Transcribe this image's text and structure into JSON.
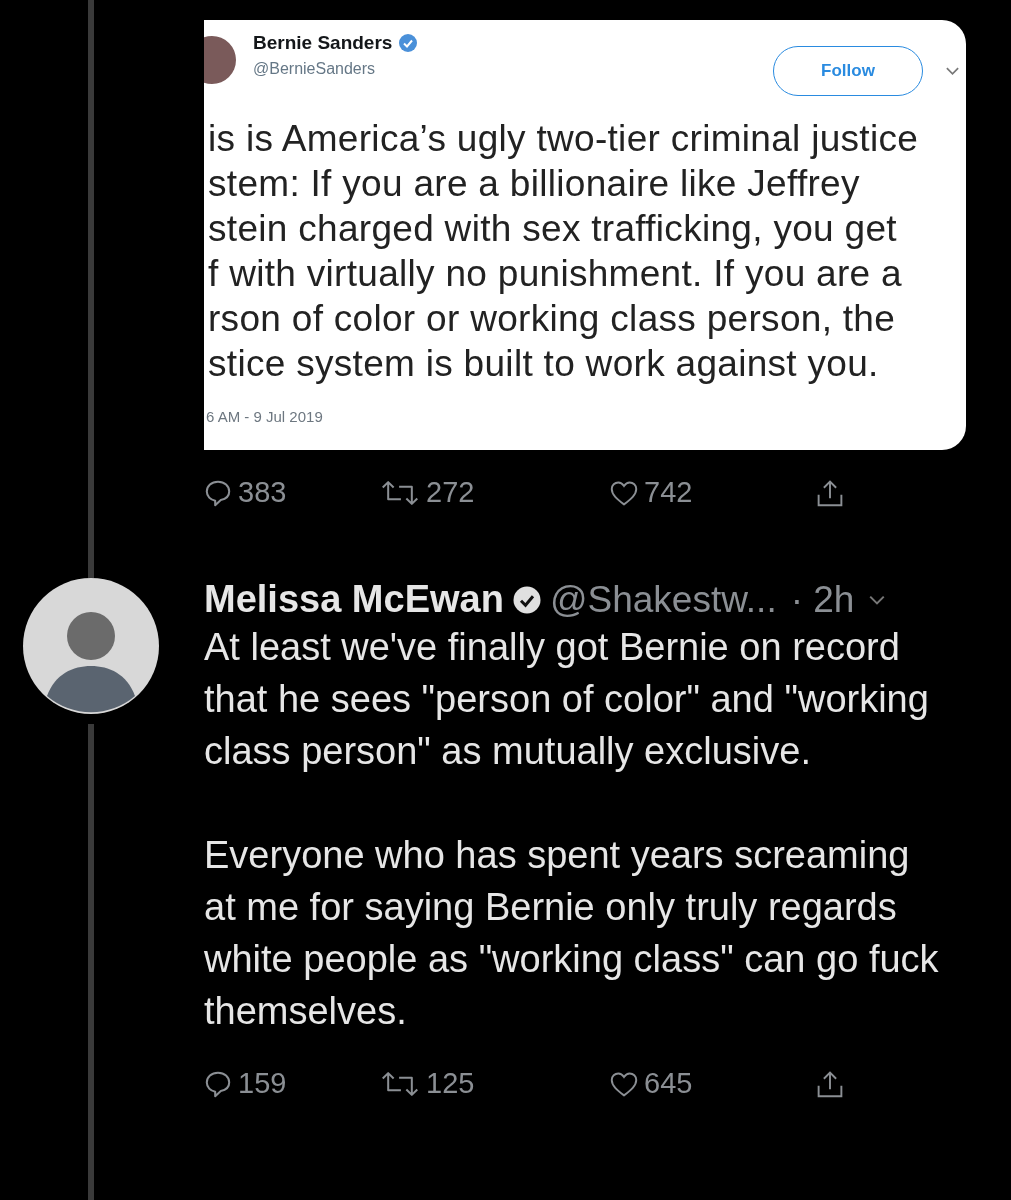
{
  "quoted_tweet": {
    "author_name": "Bernie Sanders",
    "verified": true,
    "handle": "@BernieSanders",
    "follow_button": "Follow",
    "text_lines": [
      "is is America’s ugly two-tier criminal justice",
      "stem: If you are a billionaire like Jeffrey",
      "stein charged with sex trafficking, you get",
      "f with virtually no punishment. If you are a",
      "rson of color or working class person, the",
      "stice system is built to work against you."
    ],
    "timestamp": "6 AM - 9 Jul 2019"
  },
  "quoted_actions": [
    {
      "kind": "reply",
      "count": "383"
    },
    {
      "kind": "retweet",
      "count": "272"
    },
    {
      "kind": "like",
      "count": "742"
    },
    {
      "kind": "share"
    }
  ],
  "reply": {
    "author_name": "Melissa McEwan",
    "verified": true,
    "handle": "@Shakestw...",
    "time": "· 2h",
    "paragraphs": [
      "At least we've finally got Bernie on record that he sees \"person of color\" and \"working class person\" as mutually exclusive.",
      "Everyone who has spent years screaming at me for saying Bernie only truly regards white people as \"working class\" can go fuck themselves."
    ]
  },
  "reply_actions": [
    {
      "kind": "reply",
      "count": "159"
    },
    {
      "kind": "retweet",
      "count": "125"
    },
    {
      "kind": "like",
      "count": "645"
    },
    {
      "kind": "share"
    }
  ]
}
